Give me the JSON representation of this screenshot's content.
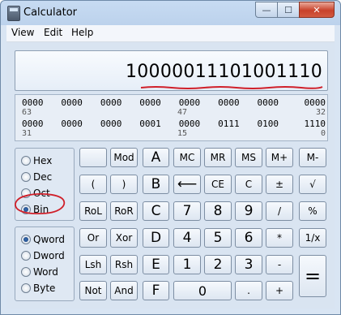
{
  "window": {
    "title": "Calculator"
  },
  "title_buttons": {
    "minimize": "—",
    "maximize": "☐",
    "close": "✕"
  },
  "menu": [
    "View",
    "Edit",
    "Help"
  ],
  "display": {
    "value": "10000011101001110"
  },
  "bit_display": {
    "row1_bits": [
      "0000",
      "0000",
      "0000",
      "0000",
      "0000",
      "0000",
      "0000",
      "0000"
    ],
    "row1_positions": [
      "63",
      "47",
      "32"
    ],
    "row2_bits": [
      "0000",
      "0000",
      "0000",
      "0001",
      "0000",
      "0111",
      "0100",
      "1110"
    ],
    "row2_positions": [
      "31",
      "15",
      "0"
    ]
  },
  "radix": {
    "options": [
      "Hex",
      "Dec",
      "Oct",
      "Bin"
    ],
    "selected": "Bin"
  },
  "word_size": {
    "options": [
      "Qword",
      "Dword",
      "Word",
      "Byte"
    ],
    "selected": "Qword"
  },
  "buttons": {
    "mod": "Mod",
    "a": "A",
    "mc": "MC",
    "mr": "MR",
    "ms": "MS",
    "m_plus": "M+",
    "m_minus": "M-",
    "lparen": "(",
    "rparen": ")",
    "b": "B",
    "backspace": "⟵",
    "ce": "CE",
    "c": "C",
    "plusminus": "±",
    "sqrt": "√",
    "rol": "RoL",
    "ror": "RoR",
    "c_hex": "C",
    "seven": "7",
    "eight": "8",
    "nine": "9",
    "divide": "/",
    "percent": "%",
    "or": "Or",
    "xor": "Xor",
    "d": "D",
    "four": "4",
    "five": "5",
    "six": "6",
    "multiply": "*",
    "reciprocal": "1/x",
    "lsh": "Lsh",
    "rsh": "Rsh",
    "e": "E",
    "one": "1",
    "two": "2",
    "three": "3",
    "minus": "-",
    "equals": "=",
    "not": "Not",
    "and": "And",
    "f": "F",
    "zero": "0",
    "dot": ".",
    "plus": "+"
  }
}
